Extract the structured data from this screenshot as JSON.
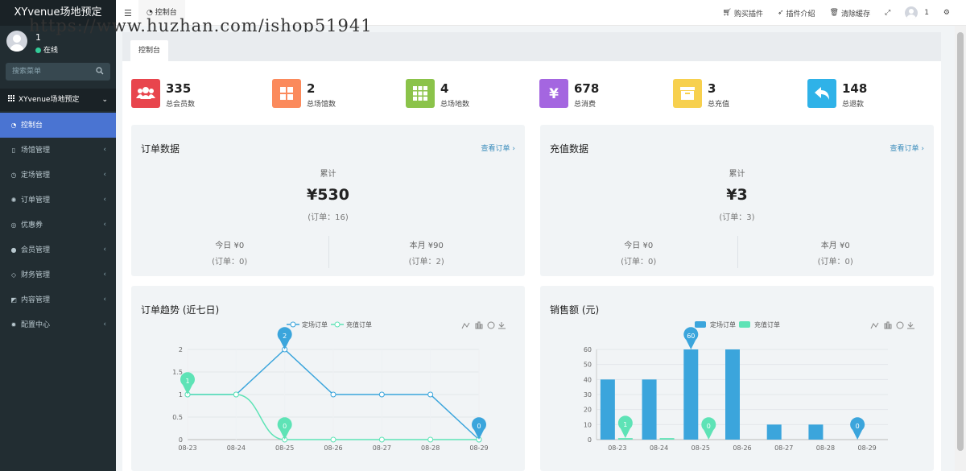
{
  "app": {
    "brand": "XYvenue场地预定",
    "watermark": "https://www.huzhan.com/ishop51941"
  },
  "sidebar": {
    "user_name": "1",
    "user_status": "在线",
    "search_placeholder": "搜索菜单",
    "header": "XYvenue场地预定",
    "items": [
      {
        "label": "控制台",
        "icon": "dashboard-icon"
      },
      {
        "label": "场馆管理",
        "icon": "book-icon"
      },
      {
        "label": "定场管理",
        "icon": "clock-icon"
      },
      {
        "label": "订单管理",
        "icon": "gear-icon"
      },
      {
        "label": "优惠券",
        "icon": "ticket-icon"
      },
      {
        "label": "会员管理",
        "icon": "user-icon"
      },
      {
        "label": "财务管理",
        "icon": "diamond-icon"
      },
      {
        "label": "内容管理",
        "icon": "edit-icon"
      },
      {
        "label": "配置中心",
        "icon": "cog-icon"
      }
    ]
  },
  "topbar": {
    "tab": "控制台",
    "actions": {
      "buy": "购买插件",
      "intro": "插件介绍",
      "clear": "清除缓存"
    },
    "user": "1"
  },
  "content": {
    "tab": "控制台"
  },
  "stats": [
    {
      "value": "335",
      "label": "总会员数",
      "color": "#e8454d",
      "icon": "users-icon"
    },
    {
      "value": "2",
      "label": "总场馆数",
      "color": "#fb8a5c",
      "icon": "grid-icon"
    },
    {
      "value": "4",
      "label": "总场地数",
      "color": "#8bc34a",
      "icon": "apps-icon"
    },
    {
      "value": "678",
      "label": "总消费",
      "color": "#a466e0",
      "icon": "yen-icon"
    },
    {
      "value": "3",
      "label": "总充值",
      "color": "#f7d04e",
      "icon": "archive-icon"
    },
    {
      "value": "148",
      "label": "总退款",
      "color": "#2fb2e8",
      "icon": "reply-icon"
    }
  ],
  "orders": {
    "title": "订单数据",
    "link": "查看订单 ›",
    "total_label": "累计",
    "total": "¥530",
    "total_sub": "(订单：16)",
    "today_label": "今日 ¥0",
    "today_sub": "(订单：0)",
    "month_label": "本月 ¥90",
    "month_sub": "(订单：2)"
  },
  "recharge": {
    "title": "充值数据",
    "link": "查看订单 ›",
    "total_label": "累计",
    "total": "¥3",
    "total_sub": "(订单：3)",
    "today_label": "今日 ¥0",
    "today_sub": "(订单：0)",
    "month_label": "本月 ¥0",
    "month_sub": "(订单：0)"
  },
  "trend": {
    "title": "订单趋势 (近七日)"
  },
  "sales": {
    "title": "销售额 (元)"
  },
  "colors": {
    "series1": "#3ba5dc",
    "series2": "#5ee3b6"
  },
  "chart_data": [
    {
      "type": "line",
      "title": "订单趋势 (近七日)",
      "categories": [
        "08-23",
        "08-24",
        "08-25",
        "08-26",
        "08-27",
        "08-28",
        "08-29"
      ],
      "series": [
        {
          "name": "定场订单",
          "values": [
            1,
            1,
            2,
            1,
            1,
            1,
            0
          ]
        },
        {
          "name": "充值订单",
          "values": [
            1,
            1,
            0,
            0,
            0,
            0,
            0
          ]
        }
      ],
      "ylim": [
        0,
        2
      ],
      "yticks": [
        "0",
        "0.5",
        "1",
        "1.5",
        "2"
      ],
      "pins": [
        {
          "series": 0,
          "index": 2,
          "label": "2"
        },
        {
          "series": 0,
          "index": 6,
          "label": "0"
        },
        {
          "series": 1,
          "index": 0,
          "label": "1"
        },
        {
          "series": 1,
          "index": 2,
          "label": "0"
        }
      ],
      "legend": "top-center",
      "grid": true
    },
    {
      "type": "bar",
      "title": "销售额 (元)",
      "categories": [
        "08-23",
        "08-24",
        "08-25",
        "08-26",
        "08-27",
        "08-28",
        "08-29"
      ],
      "series": [
        {
          "name": "定场订单",
          "values": [
            40,
            40,
            60,
            60,
            10,
            10,
            0
          ]
        },
        {
          "name": "充值订单",
          "values": [
            1,
            1,
            0,
            0,
            0,
            0,
            0
          ]
        }
      ],
      "ylim": [
        0,
        60
      ],
      "yticks": [
        "0",
        "10",
        "20",
        "30",
        "40",
        "50",
        "60"
      ],
      "pins": [
        {
          "series": 0,
          "index": 2,
          "label": "60"
        },
        {
          "series": 0,
          "index": 6,
          "label": "0"
        },
        {
          "series": 1,
          "index": 0,
          "label": "1"
        },
        {
          "series": 1,
          "index": 2,
          "label": "0"
        }
      ],
      "legend": "top-center",
      "grid": true
    }
  ]
}
